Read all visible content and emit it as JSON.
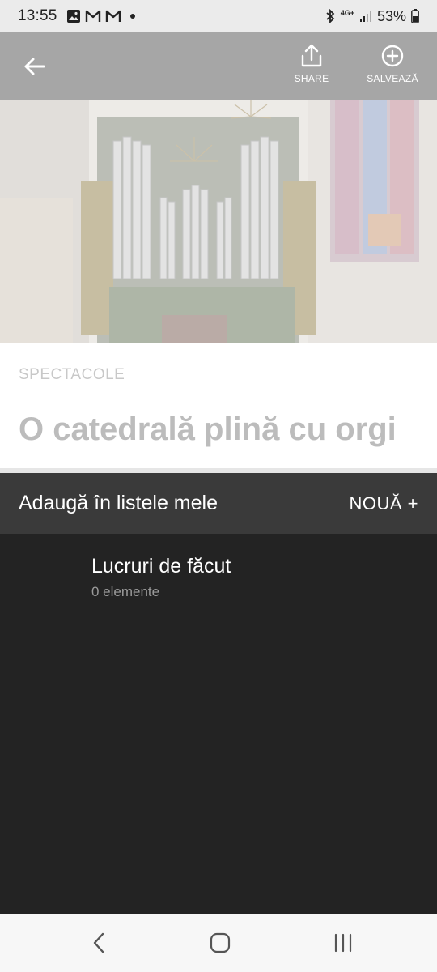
{
  "status_bar": {
    "time": "13:55",
    "network": "4G+",
    "battery": "53%",
    "icons": [
      "gallery-icon",
      "gmail-icon",
      "gmail-icon",
      "notification-dot",
      "bluetooth-icon",
      "signal-icon",
      "battery-icon"
    ]
  },
  "app_bar": {
    "share_label": "SHARE",
    "save_label": "SALVEAZĂ"
  },
  "article": {
    "category": "SPECTACOLE",
    "title": "O catedrală plină cu orgi"
  },
  "sheet": {
    "header": "Adaugă în listele mele",
    "new_button": "NOUĂ +",
    "lists": [
      {
        "title": "Lucruri de făcut",
        "count": "0 elemente"
      }
    ]
  },
  "colors": {
    "sheet_header_bg": "#3a3a3a",
    "sheet_body_bg": "#232323",
    "app_bar_bg": "#a6a6a6"
  }
}
